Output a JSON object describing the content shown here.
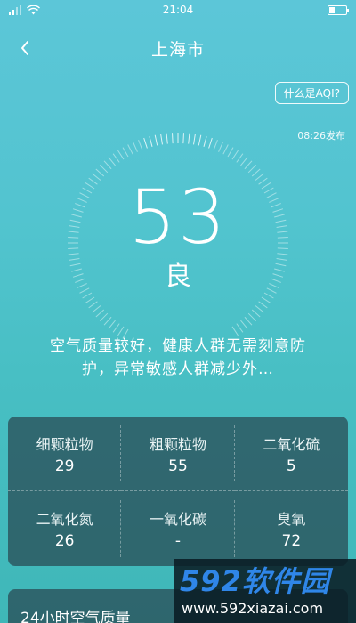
{
  "status_bar": {
    "time": "21:04"
  },
  "header": {
    "title": "上海市"
  },
  "aqi_help": {
    "label": "什么是AQI?"
  },
  "publish_time": "08:26发布",
  "aqi": {
    "value": "53",
    "level": "良"
  },
  "advice": "空气质量较好，健康人群无需刻意防护，异常敏感人群减少外…",
  "pollutants": [
    {
      "name": "细颗粒物",
      "value": "29"
    },
    {
      "name": "粗颗粒物",
      "value": "55"
    },
    {
      "name": "二氧化硫",
      "value": "5"
    },
    {
      "name": "二氧化氮",
      "value": "26"
    },
    {
      "name": "一氧化碳",
      "value": "-"
    },
    {
      "name": "臭氧",
      "value": "72"
    }
  ],
  "hourly_section": {
    "title": "24小时空气质量"
  },
  "watermark": {
    "logo": "592软件园",
    "url": "www.592xiazai.com"
  },
  "colors": {
    "accent": "#48bfc4",
    "card": "#284650",
    "watermark_blue": "#2f86e8"
  },
  "icons": {
    "back": "chevron-left-icon",
    "wifi": "wifi-icon",
    "signal": "signal-icon",
    "battery": "battery-icon"
  }
}
